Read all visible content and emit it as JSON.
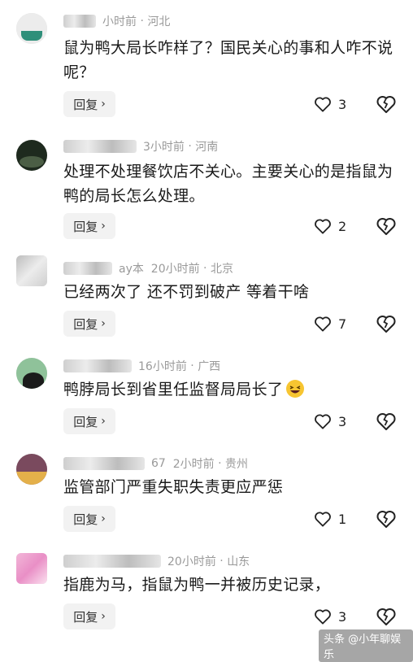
{
  "colors": {
    "text": "#1a1a1a",
    "meta": "#9a9a9a",
    "reply_bg": "#f2f2f2"
  },
  "reply_label": "回复",
  "comments": [
    {
      "meta_fragment": "小时前",
      "time_prefix": "",
      "location": "河北",
      "text": "鼠为鸭大局长咋样了？国民关心的事和人咋不说呢？",
      "likes": "3",
      "avatar_colors": [
        "#e6e6e6",
        "#2f8f7a"
      ]
    },
    {
      "meta_fragment": "",
      "time_prefix": "3小时前",
      "location": "河南",
      "text": "处理不处理餐饮店不关心。主要关心的是指鼠为鸭的局长怎么处理。",
      "likes": "2",
      "avatar_colors": [
        "#1e2a1e",
        "#4b5e45"
      ]
    },
    {
      "meta_fragment": "ay本",
      "time_prefix": "20小时前",
      "location": "北京",
      "text": "已经两次了 还不罚到破产 等着干啥",
      "likes": "7",
      "avatar_colors": [
        "#bdbdbd",
        "#e0e0e0"
      ]
    },
    {
      "meta_fragment": "",
      "time_prefix": "16小时前",
      "location": "广西",
      "text": "鸭脖局长到省里任监督局局长了",
      "likes": "3",
      "avatar_colors": [
        "#8fc29a",
        "#1b1b1b"
      ]
    },
    {
      "meta_fragment": "67",
      "time_prefix": "2小时前",
      "location": "贵州",
      "text": "监管部门严重失职失责更应严惩",
      "likes": "1",
      "avatar_colors": [
        "#7a4a5e",
        "#e4b04a"
      ]
    },
    {
      "meta_fragment": "",
      "time_prefix": "20小时前",
      "location": "山东",
      "text": "指鹿为马，指鼠为鸭一并被历史记录，",
      "likes": "3",
      "avatar_colors": [
        "#f2b6d8",
        "#e98fc6"
      ]
    }
  ],
  "watermark": {
    "text": "头条 @小年聊娱乐"
  },
  "icons": {
    "like": "heart-outline-icon",
    "dislike": "broken-heart-icon",
    "reply": "chevron-right-icon"
  }
}
